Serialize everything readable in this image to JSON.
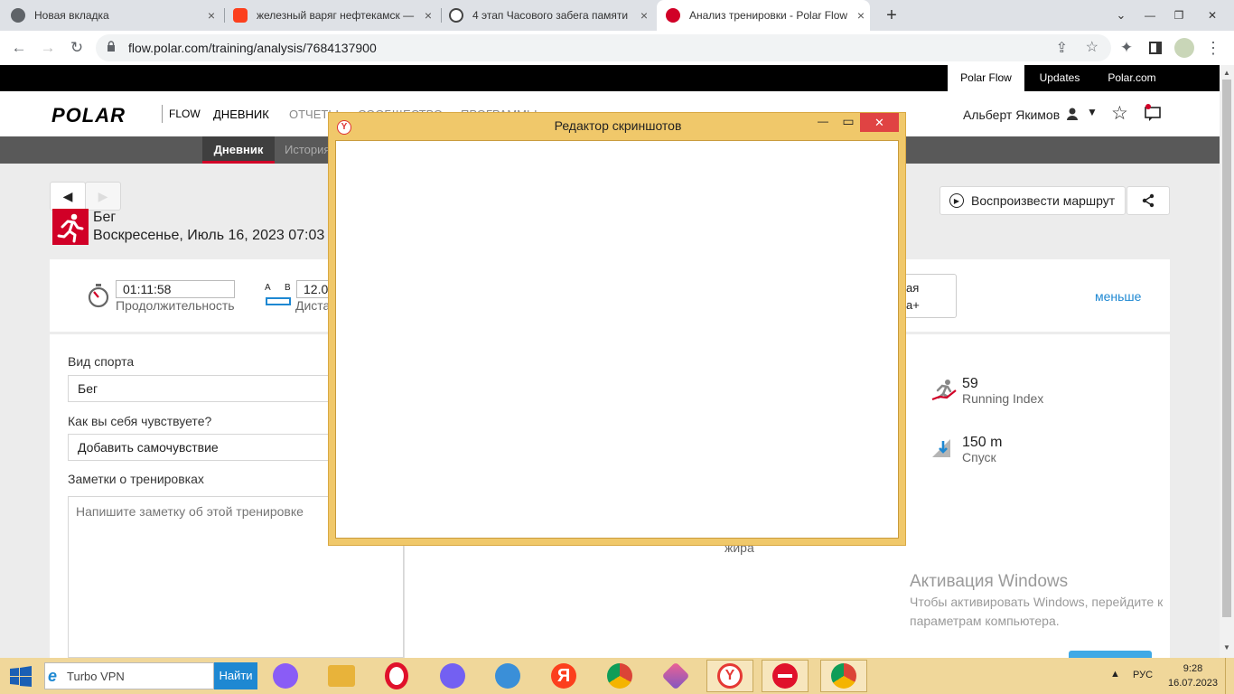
{
  "browser": {
    "tabs": [
      {
        "title": "Новая вкладка",
        "close": "×"
      },
      {
        "title": "железный варяг нефтекамск —",
        "close": "×"
      },
      {
        "title": "4 этап Часового забега памяти",
        "close": "×"
      },
      {
        "title": "Анализ тренировки - Polar Flow",
        "close": "×"
      }
    ],
    "new_tab": "+",
    "url": "flow.polar.com/training/analysis/7684137900",
    "window_controls": [
      "⌄",
      "—",
      "❐",
      "✕"
    ]
  },
  "polar": {
    "topbar": [
      "Polar Flow",
      "Updates",
      "Polar.com"
    ],
    "logo": "POLAR",
    "flow": "FLOW",
    "nav": [
      "ДНЕВНИК",
      "ОТЧЕТЫ",
      "СООБЩЕСТВО",
      "ПРОГРАММЫ"
    ],
    "user": "Альберт Якимов",
    "subnav": [
      "Дневник",
      "История"
    ],
    "prev": "◀",
    "next": "▶",
    "sport": "Бег",
    "date": "Воскресенье, Июль 16, 2023 07:03",
    "replay": "Воспроизвести маршрут",
    "duration_value": "01:11:58",
    "duration_label": "Продолжительность",
    "distance_value": "12.0",
    "distance_label": "Дистанция",
    "ab_a": "A",
    "ab_b": "B",
    "partial_box_l1": "ая",
    "partial_box_l2": "а+",
    "less": "меньше",
    "sport_label": "Вид спорта",
    "sport_value": "Бег",
    "feel_label": "Как вы себя чувствуете?",
    "feel_value": "Добавить самочувствие",
    "notes_label": "Заметки о тренировках",
    "notes_placeholder": "Напишите заметку об этой тренировке",
    "running_index_value": "59",
    "running_index_label": "Running Index",
    "descent_value": "150 m",
    "descent_label": "Спуск",
    "fat_label": "жира"
  },
  "dialog": {
    "title": "Редактор скриншотов",
    "min": "—",
    "max": "▭",
    "close": "✕"
  },
  "watermark": {
    "title": "Активация Windows",
    "line1": "Чтобы активировать Windows, перейдите к",
    "line2": "параметрам компьютера."
  },
  "taskbar": {
    "search_text": "Turbo VPN",
    "search_button": "Найти",
    "lang": "РУС",
    "time": "9:28",
    "date": "16.07.2023"
  },
  "colors": {
    "polar_red": "#d10027",
    "link_blue": "#1e88d2",
    "dialog_frame": "#f0c86a"
  }
}
